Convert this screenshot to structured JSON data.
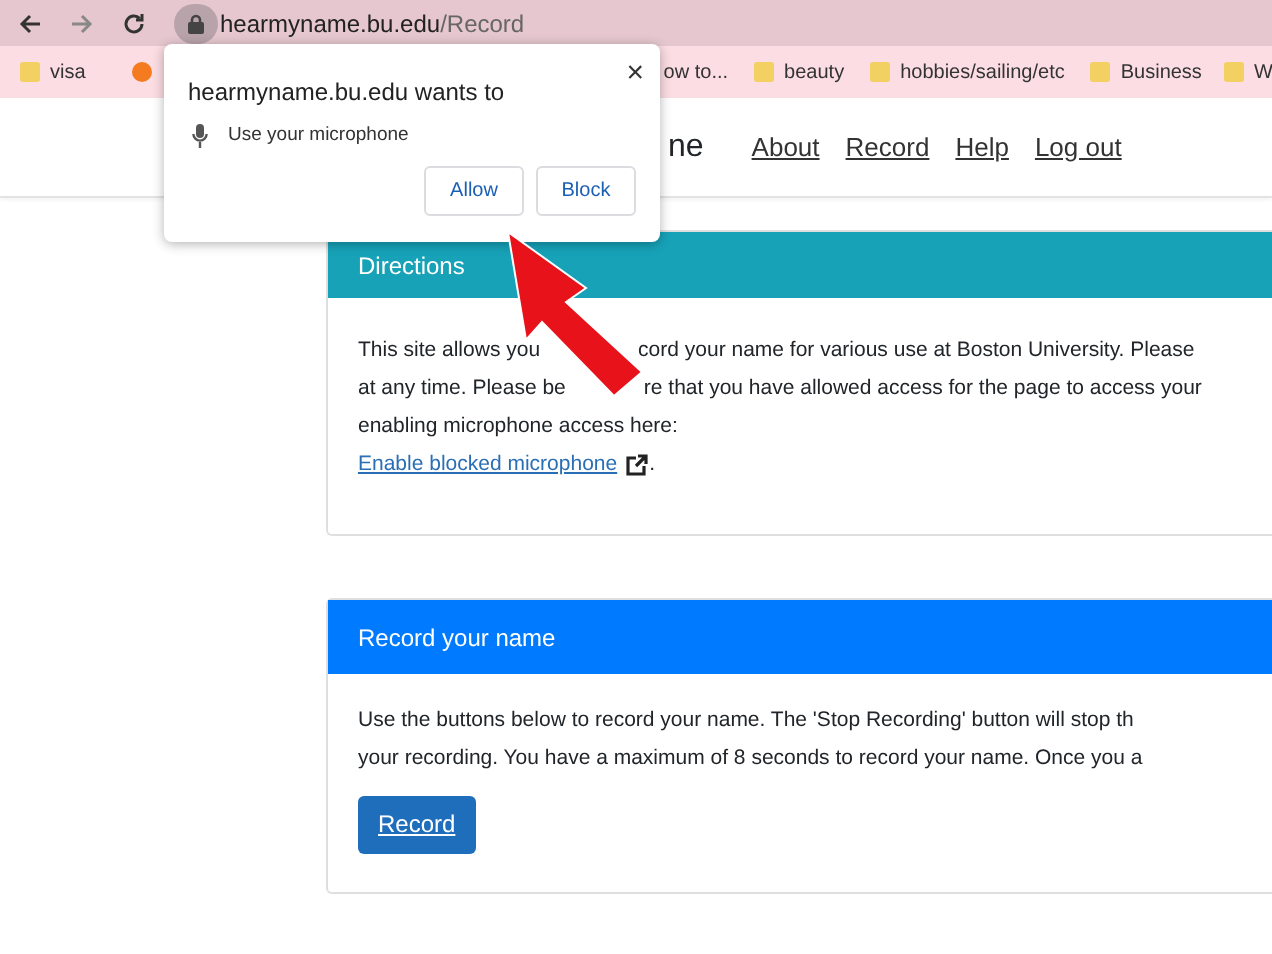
{
  "browser": {
    "url_host": "hearmyname.bu.edu",
    "url_path": "/Record"
  },
  "bookmarks": [
    {
      "label": "visa",
      "kind": "folder"
    },
    {
      "kind": "site"
    },
    {
      "label": "ow to...",
      "kind": "text"
    },
    {
      "label": "beauty",
      "kind": "folder"
    },
    {
      "label": "hobbies/sailing/etc",
      "kind": "folder"
    },
    {
      "label": "Business",
      "kind": "folder"
    },
    {
      "label": "W",
      "kind": "folder"
    }
  ],
  "navbar": {
    "title_fragment": "ne",
    "links": [
      "About",
      "Record",
      "Help",
      "Log out"
    ]
  },
  "permission_popup": {
    "title": "hearmyname.bu.edu wants to",
    "request": "Use your microphone",
    "close": "×",
    "buttons": [
      "Allow",
      "Block"
    ]
  },
  "directions": {
    "header": "Directions",
    "lines": [
      [
        "This site allows you",
        "cord your name for various use at Boston University. Please"
      ],
      [
        "at any time. Please be",
        "re that you have allowed access for the page to access your"
      ],
      [
        "enabling microphone access here:"
      ]
    ],
    "link": "Enable blocked microphone",
    "after_link": "."
  },
  "record_card": {
    "header": "Record your name",
    "lines": [
      "Use the buttons below to record your name. The 'Stop Recording' button will stop th",
      "your recording. You have a maximum of 8 seconds to record your name. Once you a"
    ],
    "button": "Record"
  }
}
